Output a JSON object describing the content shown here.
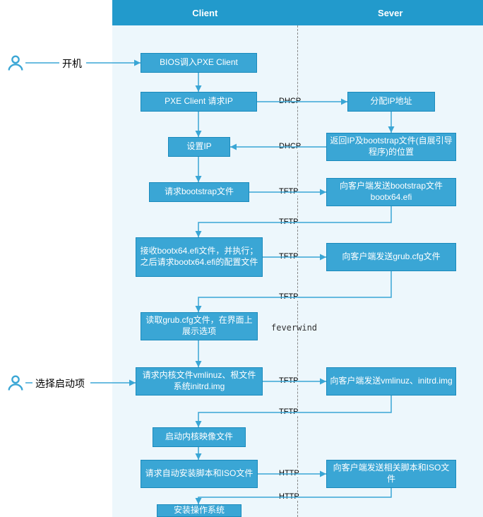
{
  "header": {
    "client": "Client",
    "server": "Sever"
  },
  "external": {
    "poweron": "开机",
    "select": "选择启动项"
  },
  "client": {
    "b1": "BIOS调入PXE Client",
    "b2": "PXE Client 请求IP",
    "b3": "设置IP",
    "b4": "请求bootstrap文件",
    "b5": "接收bootx64.efi文件，并执行；之后请求bootx64.efi的配置文件",
    "b6": "读取grub.cfg文件，在界面上展示选项",
    "b7": "请求内核文件vmlinuz、根文件系统initrd.img",
    "b8": "启动内核映像文件",
    "b9": "请求自动安装脚本和ISO文件",
    "b10": "安装操作系统"
  },
  "server": {
    "s1": "分配IP地址",
    "s2": "返回IP及bootstrap文件(自展引导程序)的位置",
    "s3": "向客户端发送bootstrap文件bootx64.efi",
    "s4": "向客户端发送grub.cfg文件",
    "s5": "向客户端发送vmlinuz、initrd.img",
    "s6": "向客户端发送相关脚本和ISO文件"
  },
  "proto": {
    "dhcp": "DHCP",
    "tftp": "TFTP",
    "http": "HTTP"
  },
  "watermark": "feverwind"
}
